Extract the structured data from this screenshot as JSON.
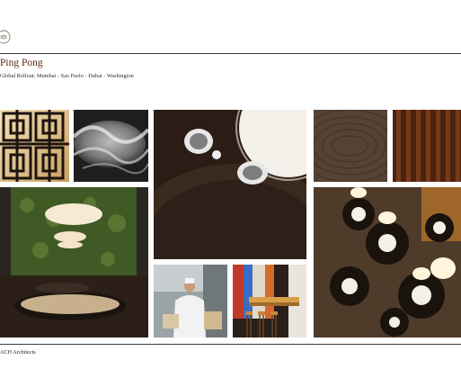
{
  "header": {
    "logo_icon": "circular-monogram-logo",
    "title": "Ping Pong",
    "subtitle": "Global Rollout: Mumbai - Sao Paolo - Dubai - Washington"
  },
  "footer": {
    "text": "ACH Architects"
  },
  "palette": {
    "title_color": "#5a1f12",
    "rule_color": "#3a3a3a"
  }
}
